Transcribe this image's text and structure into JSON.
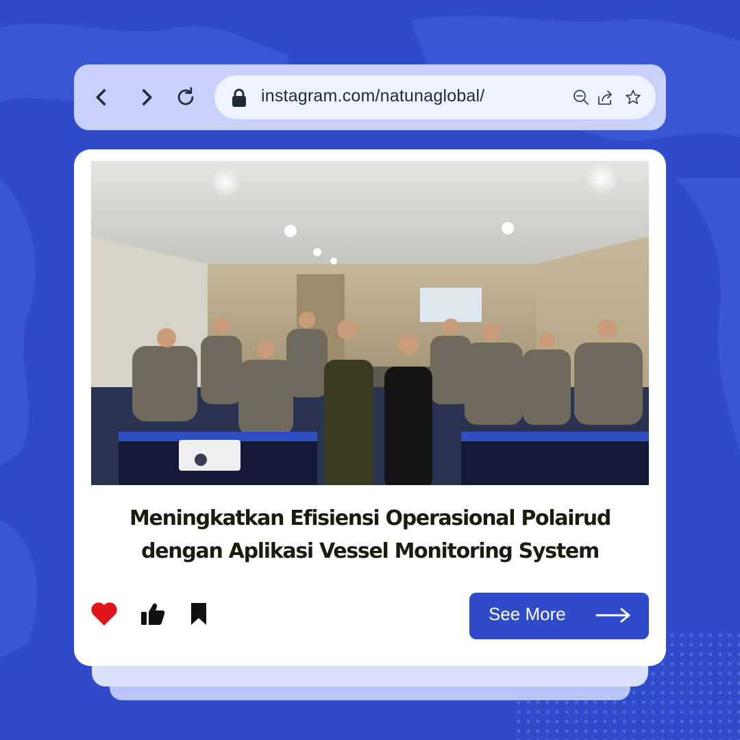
{
  "browser": {
    "url": "instagram.com/natunaglobal/",
    "icons": [
      "back-icon",
      "forward-icon",
      "reload-icon",
      "lock-icon",
      "zoom-out-icon",
      "share-icon",
      "star-icon"
    ]
  },
  "post": {
    "headline_line1": "Meningkatkan Efisiensi Operasional Polairud",
    "headline_line2": "dengan Aplikasi Vessel Monitoring System",
    "see_more_label": "See More",
    "actions": [
      "heart-icon",
      "thumbs-up-icon",
      "bookmark-icon"
    ]
  },
  "colors": {
    "background": "#2f4bc9",
    "browser_bar": "#c7d1fa",
    "url_field": "#eef3ff",
    "card": "#ffffff",
    "heart": "#e0151b",
    "button": "#2f4bc9"
  }
}
